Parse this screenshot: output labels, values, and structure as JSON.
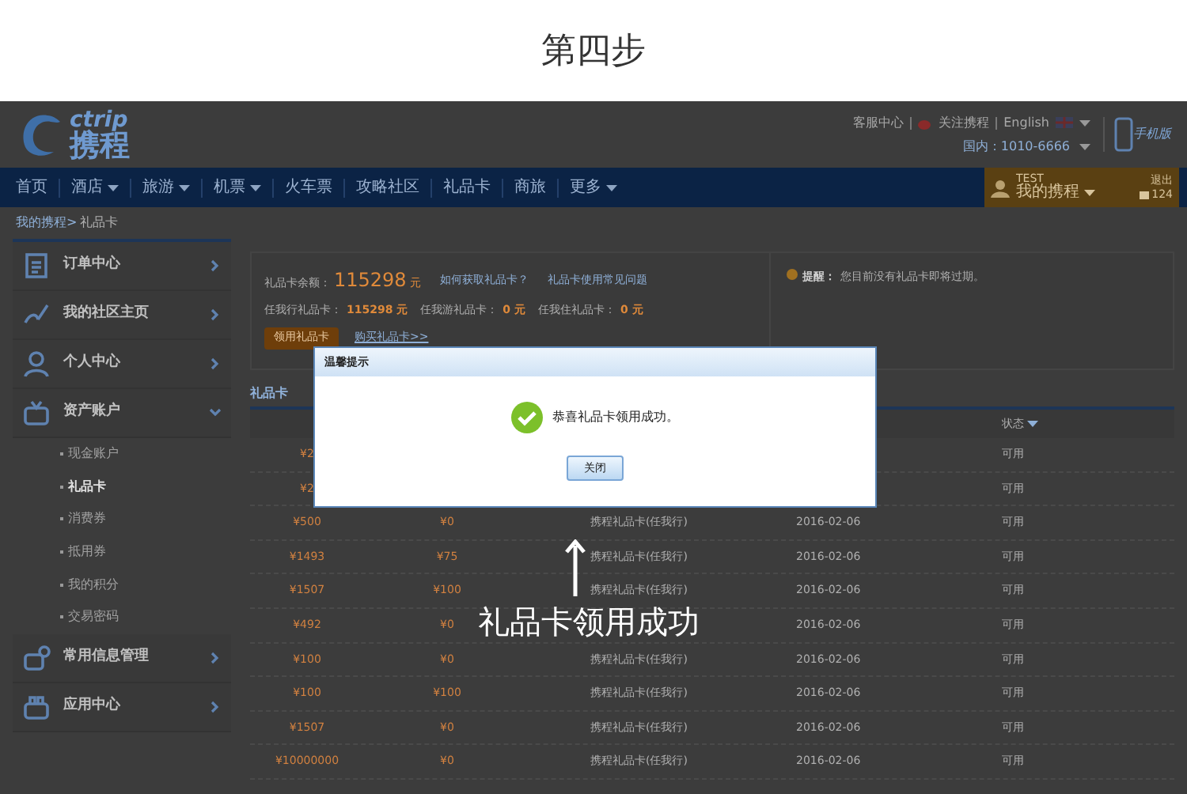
{
  "step_title": "第四步",
  "header": {
    "logo_text": "ctrip",
    "logo_name": "携程",
    "links": [
      "客服中心",
      "关注携程",
      "English"
    ],
    "hotline": "国内：1010-6666",
    "mobile": "手机版"
  },
  "nav": {
    "items": [
      {
        "label": "首页",
        "dropdown": false
      },
      {
        "label": "酒店",
        "dropdown": true
      },
      {
        "label": "旅游",
        "dropdown": true
      },
      {
        "label": "机票",
        "dropdown": true
      },
      {
        "label": "火车票",
        "dropdown": false
      },
      {
        "label": "攻略社区",
        "dropdown": false
      },
      {
        "label": "礼品卡",
        "dropdown": false
      },
      {
        "label": "商旅",
        "dropdown": false
      },
      {
        "label": "更多",
        "dropdown": true
      }
    ],
    "user": {
      "name": "TEST",
      "menu": "我的携程",
      "logout": "退出",
      "messages": "124"
    }
  },
  "breadcrumb": [
    "我的携程>",
    "礼品卡"
  ],
  "sidebar": [
    {
      "label": "订单中心",
      "kind": "order",
      "expanded": false
    },
    {
      "label": "我的社区主页",
      "kind": "community",
      "expanded": false
    },
    {
      "label": "个人中心",
      "kind": "person",
      "expanded": false
    },
    {
      "label": "资产账户",
      "kind": "wallet",
      "expanded": true,
      "children": [
        {
          "label": "现金账户",
          "selected": false
        },
        {
          "label": "礼品卡",
          "selected": true
        },
        {
          "label": "消费券",
          "selected": false
        },
        {
          "label": "抵用券",
          "selected": false
        },
        {
          "label": "我的积分",
          "selected": false
        },
        {
          "label": "交易密码",
          "selected": false
        }
      ]
    },
    {
      "label": "常用信息管理",
      "kind": "info",
      "expanded": false
    },
    {
      "label": "应用中心",
      "kind": "apps",
      "expanded": false
    }
  ],
  "summary": {
    "balance_label": "礼品卡余额：",
    "balance": "115298",
    "unit": "元",
    "links": [
      "如何获取礼品卡？",
      "礼品卡使用常见问题"
    ],
    "types": [
      {
        "label": "任我行礼品卡：",
        "value": "115298 元"
      },
      {
        "label": "任我游礼品卡：",
        "value": "0 元"
      },
      {
        "label": "任我住礼品卡：",
        "value": "0 元"
      }
    ],
    "button": "领用礼品卡",
    "buy_link": "购买礼品卡>>",
    "notice_label": "提醒：",
    "notice": "您目前没有礼品卡即将过期。"
  },
  "tab": "礼品卡",
  "status_header": "状态",
  "rows": [
    {
      "amount": "¥2",
      "status": "可用"
    },
    {
      "amount": "¥2",
      "status": "可用"
    },
    {
      "amount": "¥500",
      "balance": "¥0",
      "name": "携程礼品卡(任我行)",
      "date": "2016-02-06",
      "status": "可用"
    },
    {
      "amount": "¥1493",
      "balance": "¥75",
      "name": "携程礼品卡(任我行)",
      "date": "2016-02-06",
      "status": "可用"
    },
    {
      "amount": "¥1507",
      "balance": "¥100",
      "name": "携程礼品卡(任我行)",
      "date": "2016-02-06",
      "status": "可用"
    },
    {
      "amount": "¥492",
      "balance": "¥0",
      "date": "2016-02-06",
      "status": "可用"
    },
    {
      "amount": "¥100",
      "balance": "¥0",
      "name": "携程礼品卡(任我行)",
      "date": "2016-02-06",
      "status": "可用"
    },
    {
      "amount": "¥100",
      "balance": "¥100",
      "name": "携程礼品卡(任我行)",
      "date": "2016-02-06",
      "status": "可用"
    },
    {
      "amount": "¥1507",
      "balance": "¥0",
      "name": "携程礼品卡(任我行)",
      "date": "2016-02-06",
      "status": "可用"
    },
    {
      "amount": "¥10000000",
      "balance": "¥0",
      "name": "携程礼品卡(任我行)",
      "date": "2016-02-06",
      "status": "可用"
    }
  ],
  "dialog": {
    "title": "温馨提示",
    "message": "恭喜礼品卡领用成功。",
    "button": "关闭"
  },
  "caption": "礼品卡领用成功"
}
